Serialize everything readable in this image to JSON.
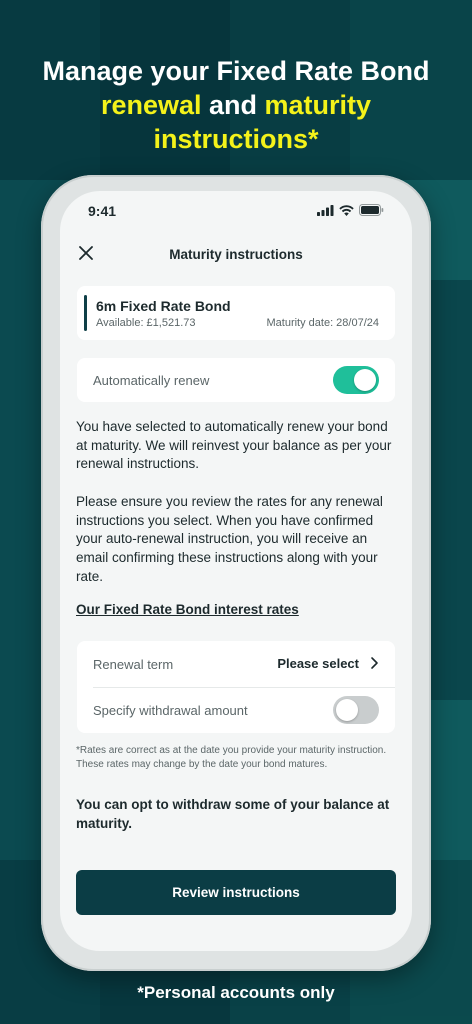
{
  "promo": {
    "headline_line1": "Manage your Fixed Rate Bond",
    "headline_hl1": "renewal",
    "headline_and": " and ",
    "headline_hl2": "maturity",
    "headline_hl3": "instructions*",
    "bottom_note": "*Personal accounts only",
    "highlight_color": "#f4f21a"
  },
  "status_bar": {
    "time": "9:41",
    "icons": [
      "signal-icon",
      "wifi-icon",
      "battery-icon"
    ]
  },
  "nav": {
    "title": "Maturity instructions",
    "close_icon": "close-icon"
  },
  "bond": {
    "name": "6m Fixed Rate Bond",
    "available": "Available: £1,521.73",
    "maturity_date": "Maturity date: 28/07/24"
  },
  "auto_renew": {
    "label": "Automatically renew",
    "enabled": true,
    "accent": "#1fbf9a"
  },
  "info": {
    "para1": "You have selected to automatically renew your bond at maturity. We will reinvest your balance as per your renewal instructions.",
    "para2": "Please ensure you review the rates for any renewal instructions you select. When you have confirmed your auto-renewal instruction, you will receive an email confirming these instructions along with your rate.",
    "link": "Our Fixed Rate Bond interest rates"
  },
  "options": {
    "renewal_term_label": "Renewal term",
    "renewal_term_value": "Please select",
    "withdrawal_label": "Specify withdrawal amount",
    "withdrawal_enabled": false
  },
  "notes": {
    "rates_disclaimer": "*Rates are correct as at the date you provide your maturity instruction. These rates may change by the date your bond matures.",
    "withdraw_note": "You can opt to withdraw some of your balance at maturity."
  },
  "cta": {
    "label": "Review instructions",
    "color": "#0b3d45"
  }
}
